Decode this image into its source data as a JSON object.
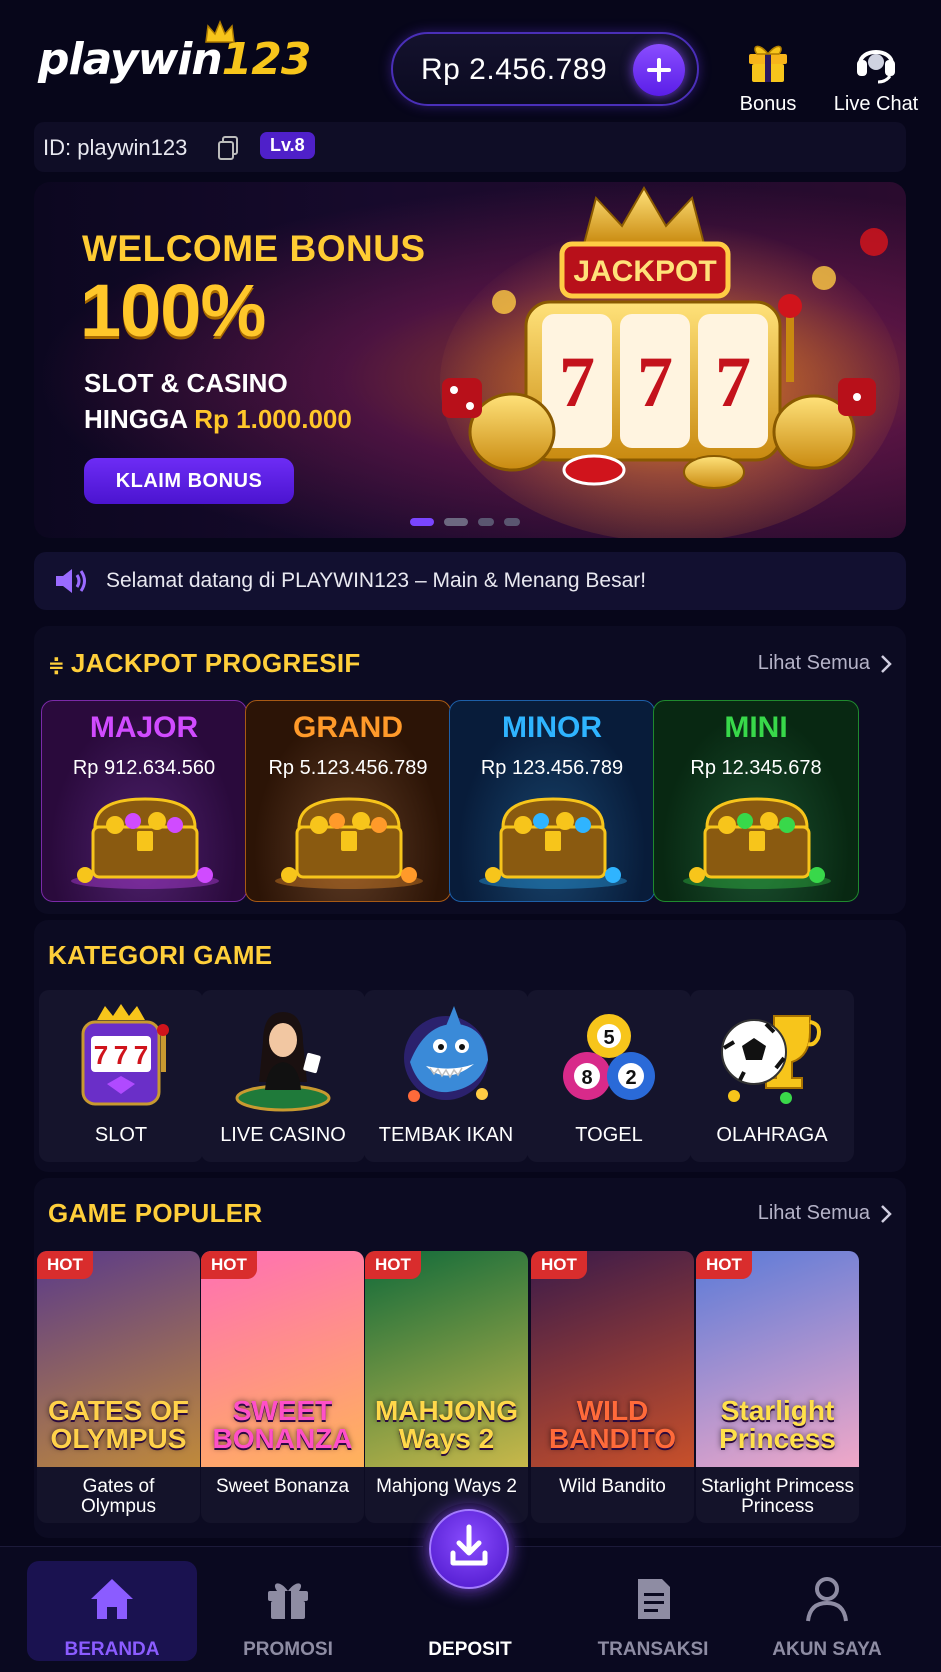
{
  "header": {
    "logo_white": "playwin",
    "logo_yellow": "123",
    "balance": "Rp 2.456.789",
    "bonus_label": "Bonus",
    "chat_label": "Live Chat"
  },
  "account": {
    "id_text": "ID: playwin123",
    "level": "Lv.8"
  },
  "banner": {
    "title1": "WELCOME BONUS",
    "title2": "100%",
    "line1": "SLOT & CASINO",
    "line2_prefix": "HINGGA",
    "line2_amount": "Rp 1.000.000",
    "cta": "KLAIM BONUS",
    "jackpot_sign": "JACKPOT",
    "reel_symbol": "7",
    "slide_active": 1,
    "slide_count": 4
  },
  "ticker": {
    "text": "Selamat datang di PLAYWIN123 – Main & Menang Besar!"
  },
  "jackpot": {
    "title": "JACKPOT PROGRESIF",
    "see_all": "Lihat Semua",
    "items": [
      {
        "name": "MAJOR",
        "amount": "Rp 912.634.560",
        "color": "#d04bff",
        "bg": "#2a0a3c",
        "border": "#7b2aa8"
      },
      {
        "name": "GRAND",
        "amount": "Rp 5.123.456.789",
        "color": "#ff9a2a",
        "bg": "#2c1406",
        "border": "#a85a14"
      },
      {
        "name": "MINOR",
        "amount": "Rp 123.456.789",
        "color": "#2fb4ff",
        "bg": "#081c3a",
        "border": "#1d5fa8"
      },
      {
        "name": "MINI",
        "amount": "Rp 12.345.678",
        "color": "#38d84a",
        "bg": "#082812",
        "border": "#1f8a2e"
      }
    ]
  },
  "categories": {
    "title": "KATEGORI GAME",
    "items": [
      {
        "label": "SLOT",
        "icon": "slot-machine-icon"
      },
      {
        "label": "LIVE CASINO",
        "icon": "live-dealer-icon"
      },
      {
        "label": "TEMBAK IKAN",
        "icon": "fish-shark-icon"
      },
      {
        "label": "TOGEL",
        "icon": "lottery-balls-icon"
      },
      {
        "label": "OLAHRAGA",
        "icon": "soccer-trophy-icon"
      }
    ],
    "togel_balls": [
      "5",
      "8",
      "2"
    ],
    "slot_reels": [
      "7",
      "7",
      "7"
    ]
  },
  "popular": {
    "title": "GAME POPULER",
    "see_all": "Lihat Semua",
    "hot_label": "HOT",
    "games": [
      {
        "name": "Gates of\nOlympus",
        "thumb_title": "GATES OF\nOLYMPUS",
        "bg1": "#5a3a8a",
        "bg2": "#c08a3a",
        "title_color": "#ffd24a"
      },
      {
        "name": "Sweet Bonanza",
        "thumb_title": "SWEET\nBONANZA",
        "bg1": "#ff6fb5",
        "bg2": "#ffb35a",
        "title_color": "#ff4fc8"
      },
      {
        "name": "Mahjong Ways 2",
        "thumb_title": "MAHJONG\nWays 2",
        "bg1": "#0f6a3a",
        "bg2": "#c8b84a",
        "title_color": "#ffd84a"
      },
      {
        "name": "Wild Bandito",
        "thumb_title": "WILD\nBANDITO",
        "bg1": "#3a1a4a",
        "bg2": "#c8502a",
        "title_color": "#ff6a3a"
      },
      {
        "name": "Starlight Primcess\nPrincess",
        "thumb_title": "Starlight\nPrincess",
        "bg1": "#5a7ad8",
        "bg2": "#f0a8c8",
        "title_color": "#ffe04a"
      }
    ]
  },
  "nav": {
    "items": [
      {
        "label": "BERANDA",
        "icon": "home-icon",
        "active": true
      },
      {
        "label": "PROMOSI",
        "icon": "gift-icon",
        "active": false
      },
      {
        "label": "DEPOSIT",
        "icon": "download-icon",
        "active": false
      },
      {
        "label": "TRANSAKSI",
        "icon": "document-icon",
        "active": false
      },
      {
        "label": "AKUN SAYA",
        "icon": "user-icon",
        "active": false
      }
    ]
  },
  "colors": {
    "accent_purple": "#6d2cf5",
    "gold": "#ffcf3a",
    "background": "#07061a",
    "hot_red": "#d92d2d"
  }
}
